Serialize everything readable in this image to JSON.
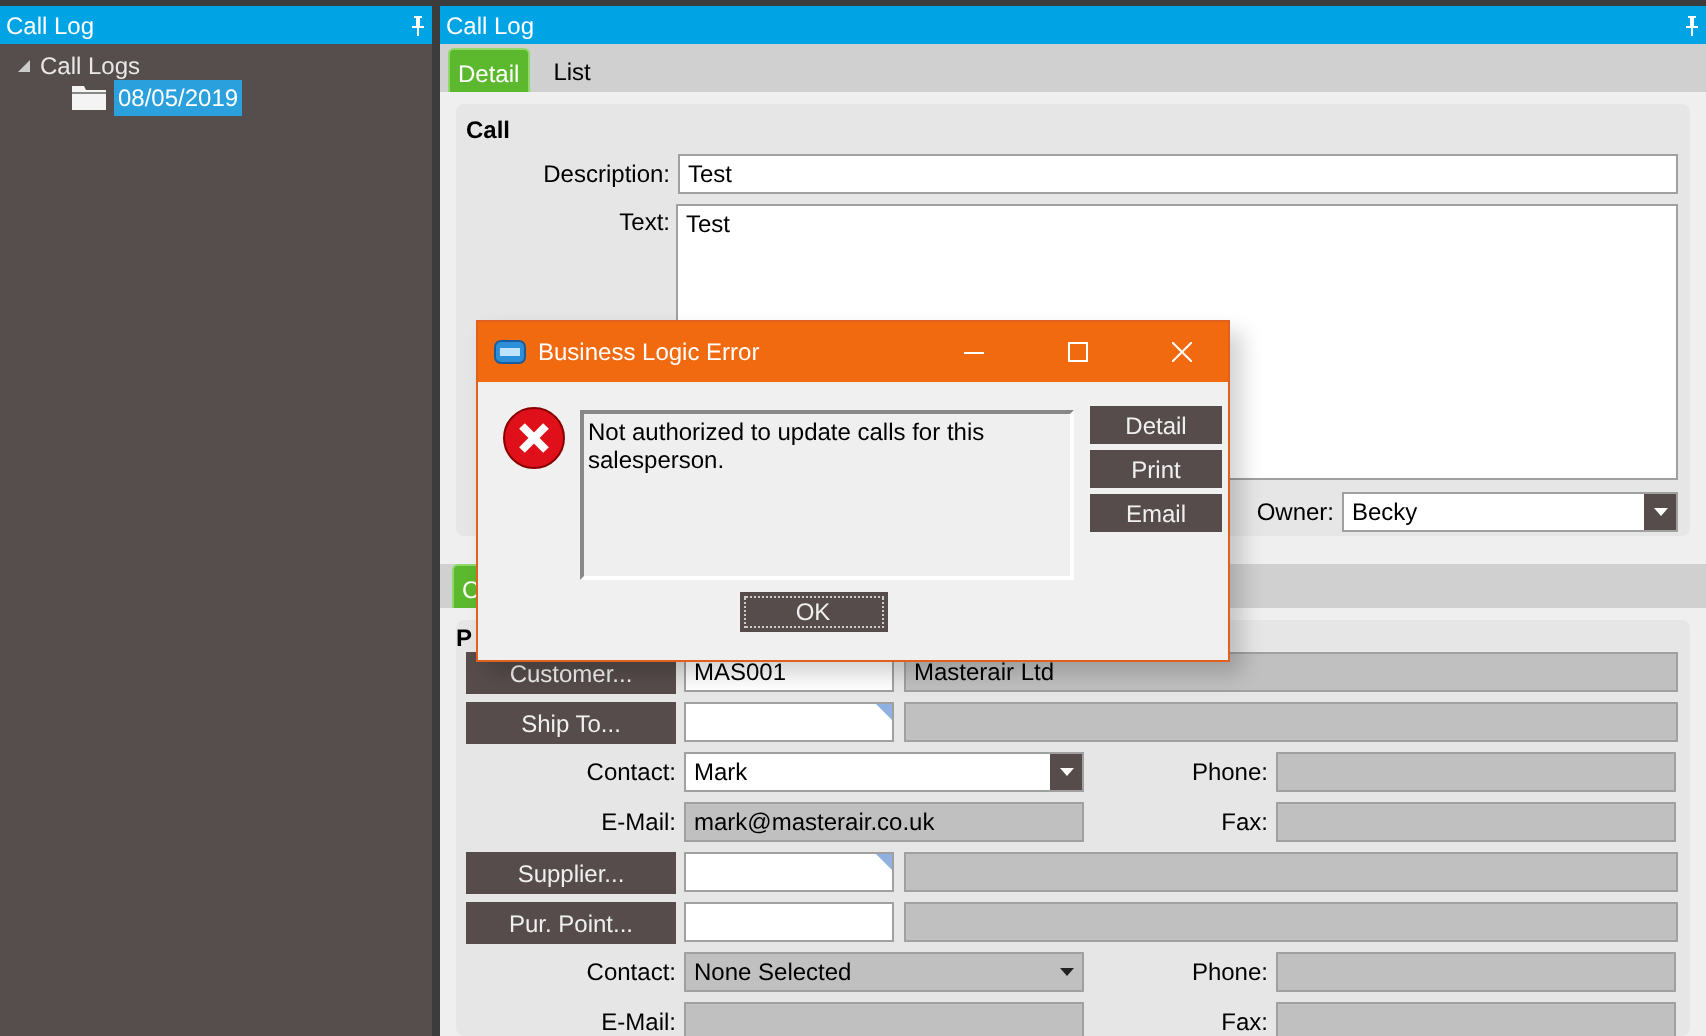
{
  "sidebar": {
    "title": "Call Log",
    "tree": [
      {
        "label": "Call Logs",
        "expanded": true,
        "selected": false,
        "children": [
          {
            "label": "08/05/2019",
            "selected": true
          }
        ]
      }
    ]
  },
  "main": {
    "title": "Call Log",
    "tabs": [
      {
        "label": "Detail",
        "selected": true
      },
      {
        "label": "List",
        "selected": false
      }
    ],
    "call_group": {
      "title": "Call",
      "description_label": "Description:",
      "description": "Test",
      "text_label": "Text:",
      "text": "Test",
      "owner_label": "Owner:",
      "owner": "Becky"
    },
    "lower_tabs": [
      {
        "label": "C",
        "selected": true
      }
    ],
    "lower_group": {
      "title": "P",
      "rows": [
        {
          "kind": "lookup",
          "button": "Customer...",
          "code": {
            "value": "MAS001",
            "marked": false
          },
          "name": {
            "value": "Masterair Ltd",
            "disabled": true
          }
        },
        {
          "kind": "lookup",
          "button": "Ship To...",
          "code": {
            "marked": true
          },
          "name": {
            "disabled": true
          }
        },
        {
          "kind": "contact",
          "label": "Contact:",
          "select": {
            "value": "Mark",
            "disabled": false
          },
          "side_label": "Phone:",
          "side": {
            "disabled": true
          }
        },
        {
          "kind": "email",
          "label": "E-Mail:",
          "field": {
            "value": "mark@masterair.co.uk",
            "disabled": true
          },
          "side_label": "Fax:",
          "side": {
            "disabled": true
          }
        },
        {
          "kind": "lookup",
          "button": "Supplier...",
          "code": {
            "marked": true
          },
          "name": {
            "disabled": true
          }
        },
        {
          "kind": "lookup",
          "button": "Pur. Point...",
          "code": {
            "marked": false
          },
          "name": {
            "disabled": true
          }
        },
        {
          "kind": "contact",
          "label": "Contact:",
          "select": {
            "value": "None Selected",
            "disabled": true
          },
          "side_label": "Phone:",
          "side": {
            "disabled": true
          }
        },
        {
          "kind": "email",
          "label": "E-Mail:",
          "field": {
            "disabled": true
          },
          "side_label": "Fax:",
          "side": {
            "disabled": true
          }
        }
      ]
    }
  },
  "dialog": {
    "title": "Business Logic Error",
    "message": "Not authorized to update calls for this salesperson.",
    "side_buttons": [
      "Detail",
      "Print",
      "Email"
    ],
    "ok": "OK"
  }
}
